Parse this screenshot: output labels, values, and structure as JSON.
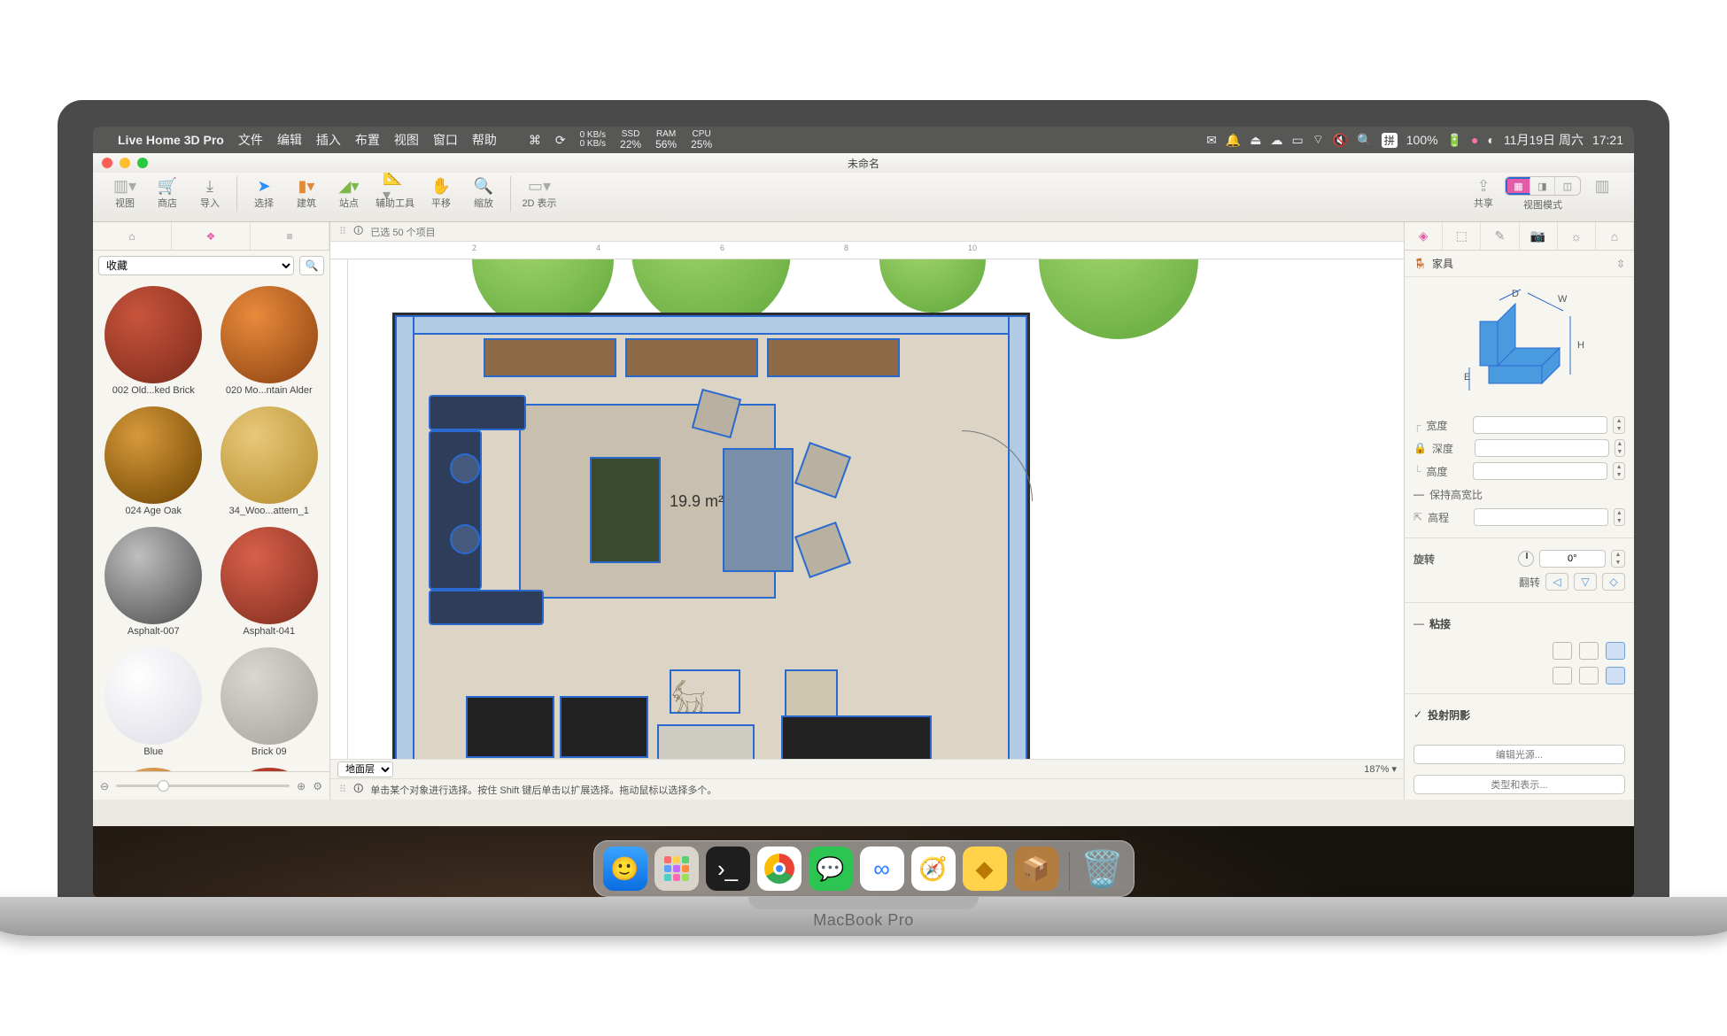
{
  "menubar": {
    "app_name": "Live Home 3D Pro",
    "items": [
      "文件",
      "编辑",
      "插入",
      "布置",
      "视图",
      "窗口",
      "帮助"
    ],
    "stats": {
      "net_down": "0 KB/s",
      "net_up": "0 KB/s",
      "ssd": "22%",
      "ram": "56%",
      "cpu": "25%"
    },
    "ime": "拼",
    "battery": "100%",
    "date": "11月19日 周六",
    "time": "17:21"
  },
  "window": {
    "title": "未命名"
  },
  "toolbar": {
    "groups": {
      "view": "视图",
      "store": "商店",
      "import": "导入",
      "select": "选择",
      "build": "建筑",
      "site": "站点",
      "helpers": "辅助工具",
      "pan": "平移",
      "zoom": "缩放",
      "rep2d": "2D 表示",
      "share": "共享",
      "view_mode": "视图模式"
    }
  },
  "left_panel": {
    "category": "收藏",
    "materials": [
      {
        "name": "002 Old...ked Brick",
        "bg": "radial-gradient(circle at 35% 30%, #c9543c, #7a2a1a)"
      },
      {
        "name": "020 Mo...ntain Alder",
        "bg": "radial-gradient(circle at 35% 30%, #e88b3c, #8a4010)"
      },
      {
        "name": "024 Age Oak",
        "bg": "radial-gradient(circle at 35% 30%, #d79a3a, #6b4100)"
      },
      {
        "name": "34_Woo...attern_1",
        "bg": "radial-gradient(circle at 35% 30%, #e8c87a, #b48a2a)"
      },
      {
        "name": "Asphalt-007",
        "bg": "radial-gradient(circle at 35% 30%, #bfbfbf, #4a4a4a)"
      },
      {
        "name": "Asphalt-041",
        "bg": "radial-gradient(circle at 35% 30%, #d9604a, #7e2c1e)"
      },
      {
        "name": "Blue",
        "bg": "radial-gradient(circle at 35% 30%, #ffffff, #dcdce6)"
      },
      {
        "name": "Brick 09",
        "bg": "radial-gradient(circle at 35% 30%, #d9d7d0, #a4a29a)"
      },
      {
        "name": "",
        "bg": "radial-gradient(circle at 35% 30%, #f2b66a, #a35a0f)"
      },
      {
        "name": "",
        "bg": "radial-gradient(circle at 35% 30%, #d04a34, #7b1e12)"
      }
    ]
  },
  "canvas": {
    "selection_status": "已选 50 个项目",
    "area_label": "19.9 m²",
    "ruler_marks": [
      "2",
      "4",
      "6",
      "8",
      "10"
    ]
  },
  "floor_bar": {
    "layer": "地面层",
    "zoom": "187%"
  },
  "hint_bar": {
    "text": "单击某个对象进行选择。按住 Shift 键后单击以扩展选择。拖动鼠标以选择多个。"
  },
  "inspector": {
    "section": "家具",
    "dims": {
      "D": "D",
      "W": "W",
      "H": "H",
      "E": "E"
    },
    "props": {
      "width_label": "宽度",
      "depth_label": "深度",
      "height_label": "高度",
      "keep_aspect_label": "保持高宽比",
      "elevation_label": "高程",
      "rotate_label": "旋转",
      "rotate_value": "0°",
      "flip_label": "翻转",
      "snap_label": "粘接",
      "shadow_label": "投射阴影",
      "edit_light_btn": "编辑光源...",
      "type_rep_btn": "类型和表示..."
    }
  },
  "dock": {
    "apps": [
      "finder",
      "launchpad",
      "term",
      "chrome",
      "wechat",
      "baidu",
      "safari",
      "sketch",
      "pkg"
    ],
    "trash": "trash"
  },
  "device_label": "MacBook Pro"
}
